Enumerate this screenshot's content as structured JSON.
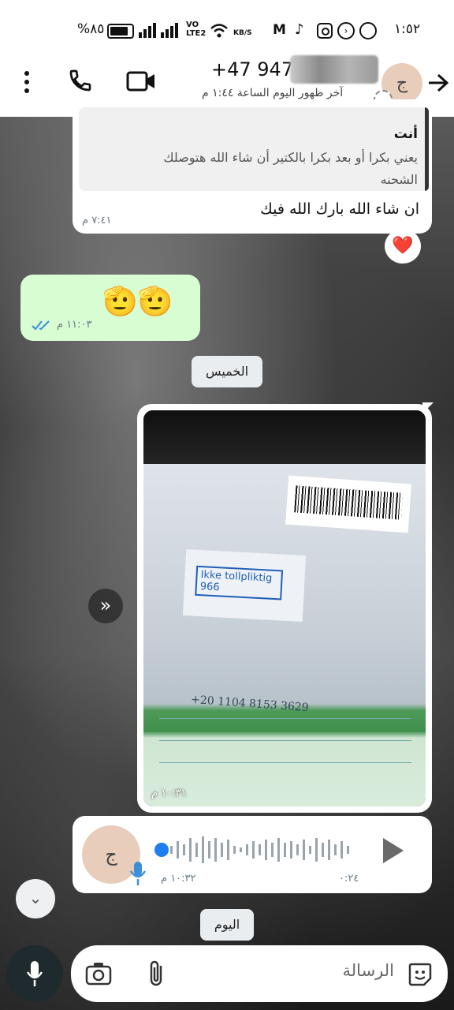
{
  "status_bar": {
    "time": "١:٥٢",
    "battery": "%٨٥",
    "net_speed": "KB/S",
    "volte": "VO LTE2"
  },
  "header": {
    "phone": "+47 947",
    "last_seen": "آخر ظهور اليوم الساعة ١:٤٤ م",
    "avatar_letter": "ج"
  },
  "messages": {
    "reply_quote": {
      "author": "أنت",
      "text_line1": "يعني بكرا أو بعد بكرا بالكتير أن شاء الله هتوصلك",
      "text_line2": "الشحنه"
    },
    "incoming_text": "ان شاء الله بارك الله فيك",
    "incoming_time": "٧:٤١ م",
    "reaction": "❤️",
    "outgoing_emojis": "🫡🫡",
    "outgoing_time": "١١:٠٣ م",
    "date_thursday": "الخميس",
    "photo_time": "١٠:٣١ م",
    "voice": {
      "avatar_letter": "ج",
      "duration": "٠:٢٤",
      "time": "١٠:٣٢ م"
    },
    "date_today": "اليوم"
  },
  "package_photo": {
    "label_text": "Ikke tollpliktig 966",
    "handwriting": "+20 1104 8153 3629"
  },
  "composer": {
    "placeholder": "الرسالة"
  }
}
